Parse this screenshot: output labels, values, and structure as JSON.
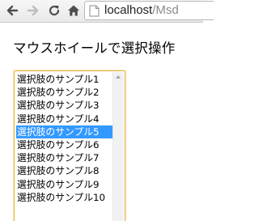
{
  "browser": {
    "url_host": "localhost",
    "url_path": "/Msd"
  },
  "page": {
    "title": "マウスホイールで選択操作"
  },
  "listbox": {
    "options": [
      "選択肢のサンプル1",
      "選択肢のサンプル2",
      "選択肢のサンプル3",
      "選択肢のサンプル4",
      "選択肢のサンプル5",
      "選択肢のサンプル6",
      "選択肢のサンプル7",
      "選択肢のサンプル8",
      "選択肢のサンプル9",
      "選択肢のサンプル10"
    ],
    "selected_index": 4
  },
  "colors": {
    "selection": "#3399ff",
    "focus_ring": "#e6b33c"
  }
}
